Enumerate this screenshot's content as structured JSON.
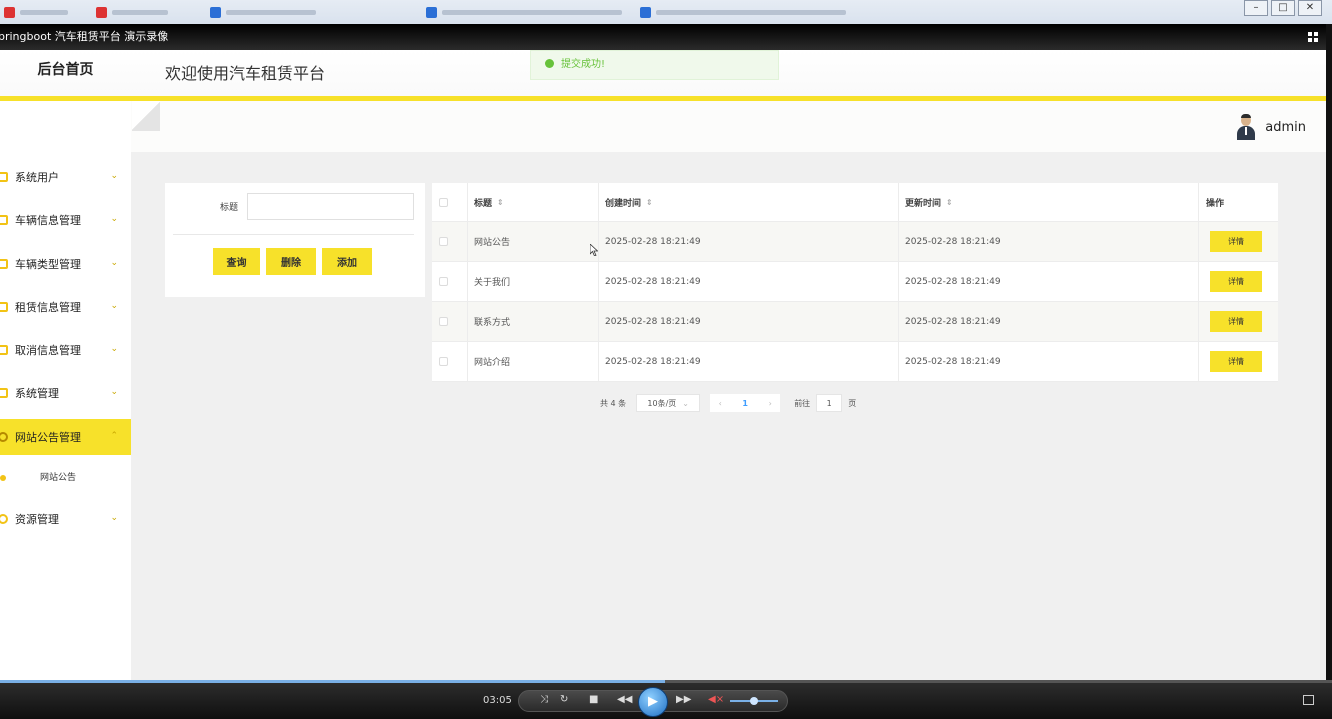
{
  "video": {
    "title": "pringboot 汽车租赁平台 演示录像",
    "time": "03:05"
  },
  "header": {
    "home_title": "后台首页",
    "welcome": "欢迎使用汽车租赁平台",
    "user": "admin"
  },
  "toast": {
    "message": "提交成功!"
  },
  "sidebar": {
    "items": [
      {
        "label": "系统用户"
      },
      {
        "label": "车辆信息管理"
      },
      {
        "label": "车辆类型管理"
      },
      {
        "label": "租赁信息管理"
      },
      {
        "label": "取消信息管理"
      },
      {
        "label": "系统管理"
      },
      {
        "label": "网站公告管理"
      },
      {
        "label": "资源管理"
      }
    ],
    "sub_item": "网站公告"
  },
  "search": {
    "label": "标题",
    "value": "",
    "buttons": {
      "query": "查询",
      "delete": "删除",
      "add": "添加"
    }
  },
  "table": {
    "columns": {
      "title": "标题",
      "created": "创建时间",
      "updated": "更新时间",
      "action": "操作"
    },
    "rows": [
      {
        "title": "网站公告",
        "created": "2025-02-28 18:21:49",
        "updated": "2025-02-28 18:21:49",
        "action": "详情"
      },
      {
        "title": "关于我们",
        "created": "2025-02-28 18:21:49",
        "updated": "2025-02-28 18:21:49",
        "action": "详情"
      },
      {
        "title": "联系方式",
        "created": "2025-02-28 18:21:49",
        "updated": "2025-02-28 18:21:49",
        "action": "详情"
      },
      {
        "title": "网站介绍",
        "created": "2025-02-28 18:21:49",
        "updated": "2025-02-28 18:21:49",
        "action": "详情"
      }
    ]
  },
  "pager": {
    "total": "共 4 条",
    "page_size": "10条/页",
    "current": "1",
    "goto_label": "前往",
    "goto_value": "1",
    "page_suffix": "页"
  }
}
